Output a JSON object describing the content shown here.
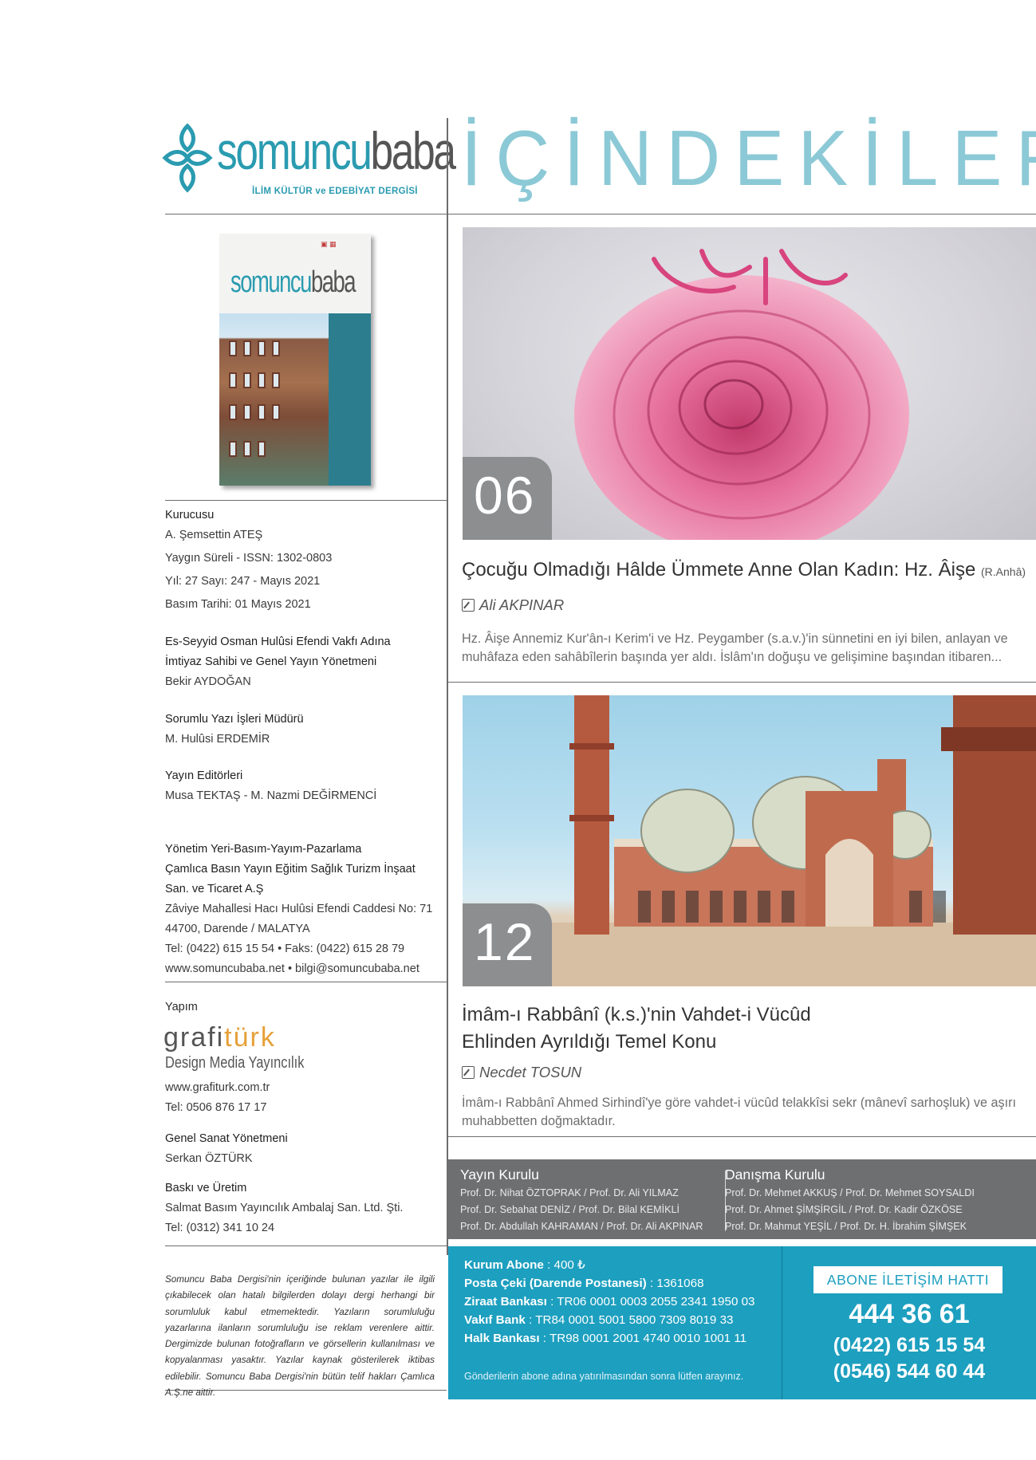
{
  "header": {
    "logo_part1": "somuncu",
    "logo_part2": "baba",
    "logo_tagline": "İLİM KÜLTÜR ve EDEBİYAT DERGİSİ",
    "section_title": "İÇİNDEKİLER"
  },
  "cover": {
    "logo_part1": "somuncu",
    "logo_part2": "baba"
  },
  "imprint": {
    "founder_label": "Kurucusu",
    "founder_name": "A. Şemsettin ATEŞ",
    "line_period_issn": "Yaygın Süreli - ISSN: 1302-0803",
    "line_year_issue": "Yıl: 27 Sayı: 247 - Mayıs 2021",
    "line_print_date": "Basım Tarihi: 01 Mayıs 2021",
    "owner_label_1": "Es-Seyyid Osman Hulûsi Efendi Vakfı Adına",
    "owner_label_2": "İmtiyaz Sahibi ve Genel Yayın Yönetmeni",
    "owner_name": "Bekir AYDOĞAN",
    "editor_label": "Sorumlu Yazı İşleri Müdürü",
    "editor_name": "M. Hulûsi ERDEMİR",
    "pub_editors_label": "Yayın Editörleri",
    "pub_editors_names": "Musa TEKTAŞ - M. Nazmi DEĞİRMENCİ",
    "mgmt_label": "Yönetim Yeri-Basım-Yayım-Pazarlama",
    "company_1": "Çamlıca Basın Yayın Eğitim Sağlık Turizm İnşaat",
    "company_2": "San. ve Ticaret A.Ş",
    "address_1": "Zâviye Mahallesi Hacı Hulûsi Efendi Caddesi No: 71",
    "address_2": "44700, Darende / MALATYA",
    "phone_fax": "Tel: (0422) 615 15 54 • Faks: (0422) 615 28 79",
    "web_mail": "www.somuncubaba.net • bilgi@somuncubaba.net",
    "production_label": "Yapım",
    "graf_part1": "grafi",
    "graf_part2": "türk",
    "graf_sub": "Design Media Yayıncılık",
    "graf_web": "www.grafiturk.com.tr",
    "graf_tel": "Tel: 0506 876 17 17",
    "art_director_label": "Genel Sanat Yönetmeni",
    "art_director_name": "Serkan ÖZTÜRK",
    "print_label": "Baskı ve Üretim",
    "print_company": "Salmat Basım Yayıncılık Ambalaj San. Ltd. Şti.",
    "print_tel": "Tel: (0312) 341 10 24",
    "disclaimer": "Somuncu Baba Dergisi'nin içeriğinde bulunan yazılar ile ilgili çıkabilecek olan hatalı bilgilerden dolayı dergi herhangi bir sorumluluk kabul etmemektedir. Yazıların sorumluluğu yazarlarına ilanların sorumluluğu ise reklam verenlere aittir. Dergimizde bulunan fotoğrafların ve görsellerin kullanılması ve kopyalanması yasaktır. Yazılar kaynak gösterilerek iktibas edilebilir. Somuncu Baba Dergisi'nin bütün telif hakları Çamlıca A.Ş.ne aittir."
  },
  "articles": [
    {
      "number": "06",
      "title": "Çocuğu Olmadığı Hâlde Ümmete Anne Olan Kadın: Hz. Âişe",
      "title_suffix": "(R.Anhâ)",
      "author": "Ali AKPINAR",
      "excerpt": "Hz. Âişe Annemiz Kur'ân-ı Kerim'i ve Hz. Peygamber (s.a.v.)'in sünnetini en iyi bilen, anlayan ve muhâfaza eden sahâbîlerin başında yer aldı. İslâm'ın doğuşu ve gelişimine başından itibaren..."
    },
    {
      "number": "12",
      "title_line1": "İmâm-ı Rabbânî (k.s.)'nin Vahdet-i Vücûd",
      "title_line2": "Ehlinden Ayrıldığı Temel Konu",
      "author": "Necdet TOSUN",
      "excerpt": "İmâm-ı Rabbânî Ahmed Sirhindî'ye göre vahdet-i vücûd telakkîsi sekr (mânevî sarhoşluk) ve aşırı muhabbetten doğmaktadır."
    }
  ],
  "boards": {
    "publication_title": "Yayın Kurulu",
    "publication_lines": [
      "Prof. Dr. Nihat ÖZTOPRAK / Prof. Dr. Ali YILMAZ",
      "Prof. Dr. Sebahat DENİZ / Prof. Dr. Bilal KEMİKLİ",
      "Prof. Dr. Abdullah KAHRAMAN / Prof. Dr. Ali AKPINAR"
    ],
    "advisory_title": "Danışma Kurulu",
    "advisory_lines": [
      "Prof. Dr. Mehmet AKKUŞ / Prof. Dr. Mehmet SOYSALDI",
      "Prof. Dr. Ahmet ŞİMŞİRGİL / Prof. Dr. Kadir ÖZKÖSE",
      "Prof. Dr. Mahmut YEŞİL / Prof. Dr. H. İbrahim ŞİMŞEK"
    ]
  },
  "subscription": {
    "institution_label": "Kurum Abone",
    "institution_value": " : 400 ₺",
    "post_label": "Posta Çeki (Darende Postanesi)",
    "post_value": " : 1361068",
    "ziraat_label": "Ziraat Bankası",
    "ziraat_value": " : TR06 0001 0003 2055 2341 1950 03",
    "vakif_label": "Vakıf Bank",
    "vakif_value": " : TR84 0001 5001 5800 7309 8019 33",
    "halk_label": "Halk Bankası",
    "halk_value": " : TR98 0001 2001 4740 0010 1001 11",
    "note": "Gönderilerin abone adına yatırılmasından sonra lütfen arayınız."
  },
  "hotline": {
    "label": "ABONE İLETİŞİM HATTI",
    "number_main": "444 36 61",
    "number_2": "(0422) 615 15 54",
    "number_3": "(0546) 544 60 44"
  },
  "colors": {
    "brand_teal": "#2a9bb0",
    "title_light": "#8cc9d6",
    "panel_blue": "#1d9fbf",
    "panel_gray": "#6e6f71",
    "number_box": "#8d8e90",
    "accent_orange": "#e6a13a",
    "rose_pink": "#e06a98"
  }
}
